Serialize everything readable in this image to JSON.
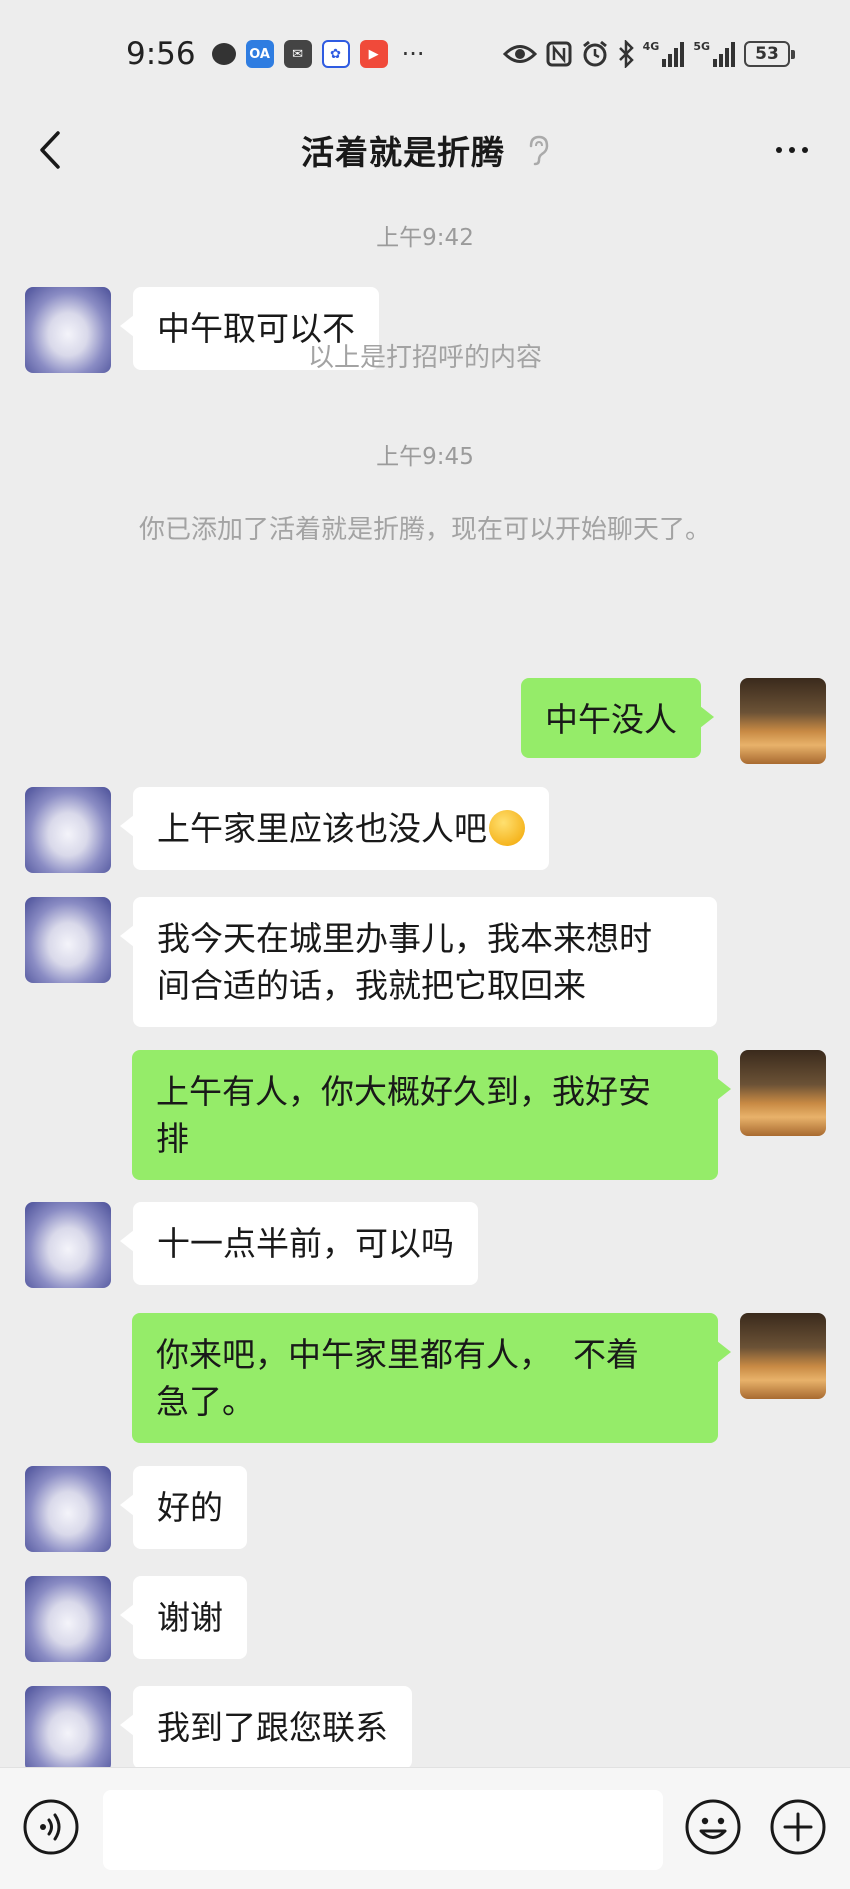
{
  "status_bar": {
    "time": "9:56",
    "more_indicator": "···",
    "network_1": "4G",
    "network_2": "5G",
    "battery": "53"
  },
  "header": {
    "title": "活着就是折腾"
  },
  "chat": {
    "time_1": "上午9:42",
    "msg_1": "中午取可以不",
    "note_1": "以上是打招呼的内容",
    "time_2": "上午9:45",
    "note_2": "你已添加了活着就是折腾，现在可以开始聊天了。",
    "msg_2": "中午没人",
    "msg_3": "上午家里应该也没人吧",
    "msg_4_line1": "我今天在城里办事儿，我本来想时",
    "msg_4_line2": "间合适的话，我就把它取回来",
    "msg_5_line1": "上午有人，你大概好久到，我好安",
    "msg_5_line2": "排",
    "msg_6": "十一点半前，可以吗",
    "msg_7_line1": "你来吧，中午家里都有人，  不着",
    "msg_7_line2": "急了。",
    "msg_8": "好的",
    "msg_9": "谢谢",
    "msg_10": "我到了跟您联系"
  },
  "input": {
    "value": ""
  },
  "colors": {
    "incoming_bubble": "#ffffff",
    "outgoing_bubble": "#95ec69",
    "background": "#ededed"
  }
}
